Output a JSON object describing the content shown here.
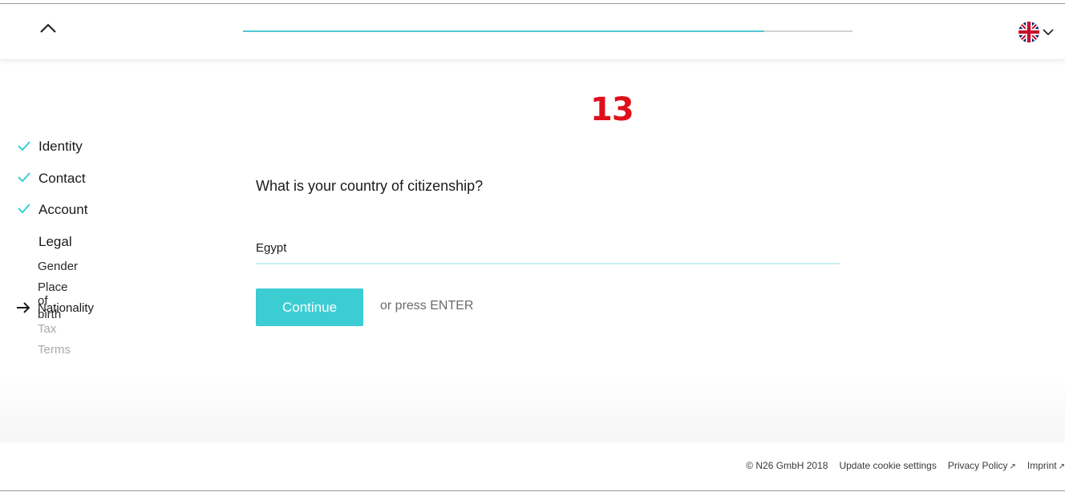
{
  "header": {
    "progress_fraction": 0.855,
    "language": "English (UK)",
    "accent_color": "#4fc9d3"
  },
  "step_number": "13",
  "nav": {
    "sections": [
      {
        "label": "Identity",
        "status": "done"
      },
      {
        "label": "Contact",
        "status": "done"
      },
      {
        "label": "Account",
        "status": "done"
      },
      {
        "label": "Legal",
        "status": "current"
      }
    ],
    "substeps": [
      {
        "label": "Gender",
        "status": "done"
      },
      {
        "label": "Place of birth",
        "status": "done"
      },
      {
        "label": "Nationality",
        "status": "current"
      },
      {
        "label": "Tax",
        "status": "pending"
      },
      {
        "label": "Terms",
        "status": "pending"
      }
    ]
  },
  "form": {
    "question": "What is your country of citizenship?",
    "answer_value": "Egypt",
    "continue_label": "Continue",
    "enter_hint": "or press ENTER",
    "button_color": "#3ccdd3"
  },
  "footer": {
    "copyright": "© N26 GmbH 2018",
    "cookie_label": "Update cookie settings",
    "privacy_label": "Privacy Policy",
    "imprint_label": "Imprint",
    "external_icon": "↗"
  }
}
